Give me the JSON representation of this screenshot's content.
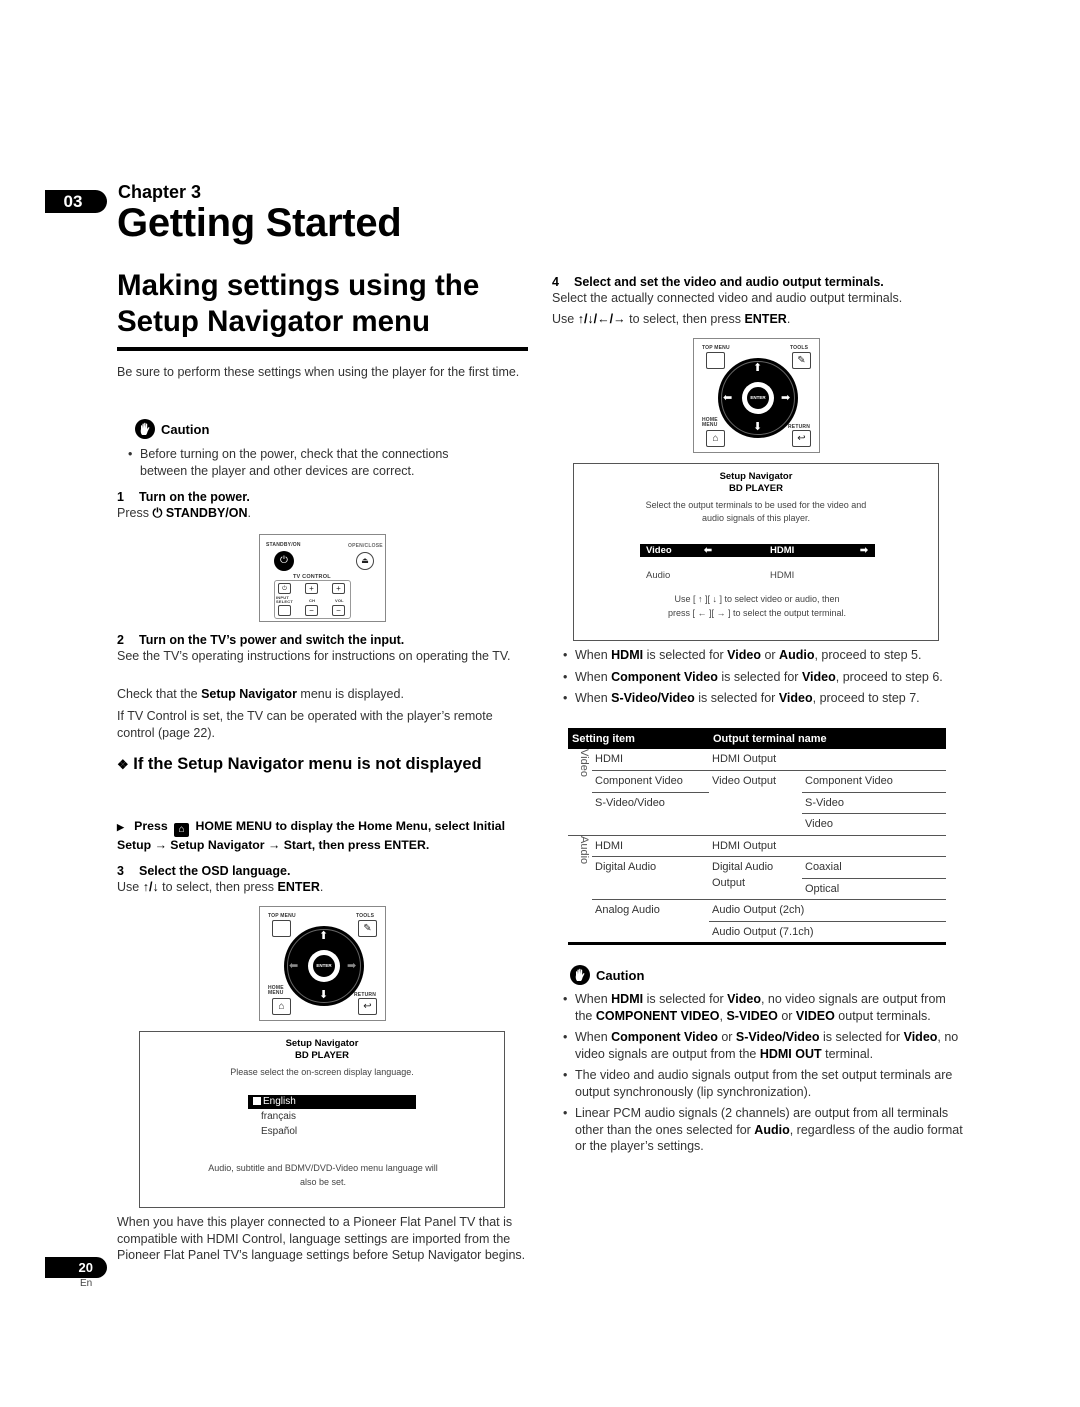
{
  "chapter": {
    "number": "03",
    "label": "Chapter 3",
    "title": "Getting Started"
  },
  "section": {
    "title": "Making settings using the Setup Navigator menu"
  },
  "intro": "Be sure to perform these settings when using the player for the first time.",
  "caution1": {
    "label": "Caution",
    "icon": "hand-stop-icon",
    "items": [
      "Before turning on the power, check that the connections between the player and other devices are correct."
    ]
  },
  "step1": {
    "num": "1",
    "title": "Turn on the power.",
    "press_prefix": "Press",
    "button": "STANDBY/ON",
    "suffix": "."
  },
  "remote1": {
    "standby_label": "STANDBY/ON",
    "open_close_label": "OPEN/CLOSE",
    "tv_control_label": "TV CONTROL",
    "input_select_label": "INPUT SELECT",
    "ch_label": "CH",
    "vol_label": "VOL"
  },
  "step2": {
    "num": "2",
    "title": "Turn on the TV’s power and switch the input.",
    "p1": "See the TV’s operating instructions for instructions on operating the TV.",
    "p2_pre": "Check that the ",
    "p2_bold": "Setup Navigator",
    "p2_post": " menu is displayed.",
    "p3": "If TV Control is set, the TV can be operated with the player’s remote control (page 22)."
  },
  "subsection": {
    "title": "If the Setup Navigator menu is not displayed"
  },
  "instruction": {
    "press": "Press",
    "text": "HOME MENU to display the Home Menu, select Initial Setup → Setup Navigator → Start, then press ENTER."
  },
  "step3": {
    "num": "3",
    "title": "Select the OSD language.",
    "use_pre": "Use",
    "keys": "↑/↓",
    "use_mid": " to select, then press ",
    "enter": "ENTER",
    "use_post": "."
  },
  "remote_nav": {
    "top_menu": "TOP MENU",
    "tools": "TOOLS",
    "enter": "ENTER",
    "home_menu": "HOME MENU",
    "return": "RETURN"
  },
  "osd_language": {
    "title": "Setup Navigator",
    "subtitle": "BD PLAYER",
    "message": "Please select the on-screen display language.",
    "options": [
      "English",
      "français",
      "Español"
    ],
    "selected": "English",
    "note": "Audio, subtitle and BDMV/DVD-Video menu language will also be set."
  },
  "hdmi_note": "When you have this player connected to a Pioneer Flat Panel TV that is compatible with HDMI Control, language settings are imported from the Pioneer Flat Panel TV’s language settings before Setup Navigator begins.",
  "step4": {
    "num": "4",
    "title": "Select and set the video and audio output terminals.",
    "p1": "Select the actually connected video and audio output terminals.",
    "use_pre": "Use ",
    "keys": "↑/↓/←/→",
    "use_mid": " to select, then press ",
    "enter": "ENTER",
    "use_post": "."
  },
  "osd_output": {
    "title": "Setup Navigator",
    "subtitle": "BD PLAYER",
    "message": "Select the output terminals to be used for the video and audio signals of this player.",
    "rows": [
      {
        "label": "Video",
        "value": "HDMI",
        "selected": true
      },
      {
        "label": "Audio",
        "value": "HDMI",
        "selected": false
      }
    ],
    "help1": "Use [ ↑ ][ ↓ ] to select video or audio, then",
    "help2": "press [ ← ][ → ] to select the output terminal."
  },
  "step_bullets": [
    {
      "pre": "When ",
      "b1": "HDMI",
      "m1": " is selected for ",
      "b2": "Video",
      "m2": " or ",
      "b3": "Audio",
      "post": ", proceed to step 5."
    },
    {
      "pre": "When ",
      "b1": "Component Video",
      "m1": " is selected for ",
      "b2": "Video",
      "m2": ", proceed to step 6.",
      "b3": "",
      "post": ""
    },
    {
      "pre": "When ",
      "b1": "S-Video/Video",
      "m1": " is selected for ",
      "b2": "Video",
      "m2": ", proceed to step 7.",
      "b3": "",
      "post": ""
    }
  ],
  "table": {
    "headers": [
      "Setting item",
      "Output terminal name"
    ],
    "groups": [
      "Video",
      "Audio"
    ],
    "video": {
      "hdmi": "HDMI",
      "hdmi_out": "HDMI Output",
      "component": "Component Video",
      "video_output": "Video Output",
      "component_term": "Component Video",
      "svideo": "S-Video/Video",
      "svideo_term": "S-Video",
      "video_term": "Video"
    },
    "audio": {
      "hdmi": "HDMI",
      "hdmi_out": "HDMI Output",
      "digital": "Digital Audio",
      "digital_out": "Digital Audio Output",
      "coaxial": "Coaxial",
      "optical": "Optical",
      "analog": "Analog Audio",
      "out_2ch": "Audio Output (2ch)",
      "out_71ch": "Audio Output (7.1ch)"
    }
  },
  "caution2": {
    "label": "Caution",
    "items": [
      {
        "parts": [
          [
            "When ",
            0
          ],
          [
            "HDMI",
            1
          ],
          [
            " is selected for ",
            0
          ],
          [
            "Video",
            1
          ],
          [
            ", no video signals are output from the ",
            0
          ],
          [
            "COMPONENT VIDEO",
            1
          ],
          [
            ", ",
            0
          ],
          [
            "S-VIDEO",
            1
          ],
          [
            " or ",
            0
          ],
          [
            "VIDEO",
            1
          ],
          [
            " output terminals.",
            0
          ]
        ]
      },
      {
        "parts": [
          [
            "When ",
            0
          ],
          [
            "Component Video",
            1
          ],
          [
            " or ",
            0
          ],
          [
            "S-Video/Video",
            1
          ],
          [
            " is selected for ",
            0
          ],
          [
            "Video",
            1
          ],
          [
            ", no video signals are output from the ",
            0
          ],
          [
            "HDMI OUT",
            1
          ],
          [
            " terminal.",
            0
          ]
        ]
      },
      {
        "parts": [
          [
            "The video and audio signals output from the set output terminals are output synchronously (lip synchronization).",
            0
          ]
        ]
      },
      {
        "parts": [
          [
            "Linear PCM audio signals (2 channels) are output from all terminals other than the ones selected for ",
            0
          ],
          [
            "Audio",
            1
          ],
          [
            ", regardless of the audio format or the player’s settings.",
            0
          ]
        ]
      }
    ]
  },
  "footer": {
    "page": "20",
    "lang": "En"
  }
}
